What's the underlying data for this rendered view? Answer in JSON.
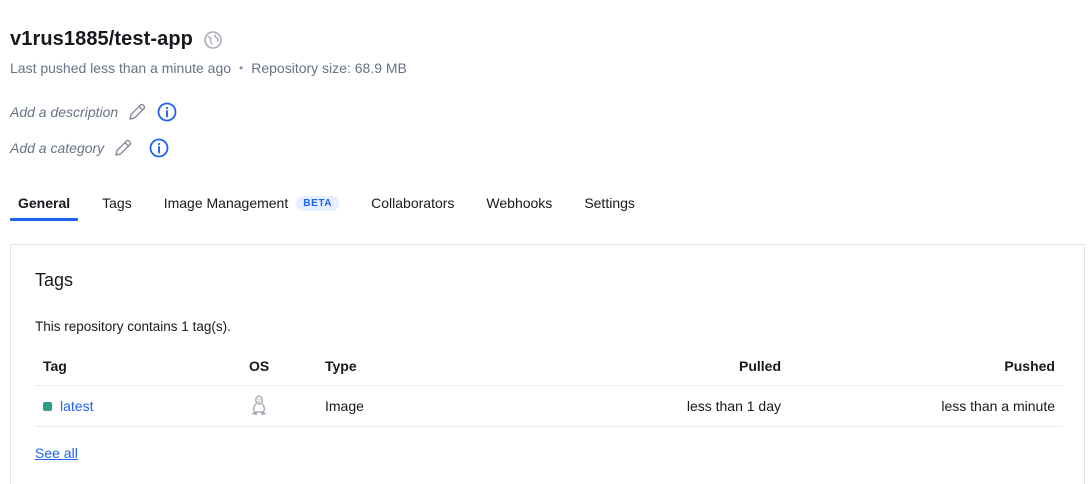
{
  "repo": {
    "name": "v1rus1885/test-app",
    "last_pushed": "Last pushed less than a minute ago",
    "separator": "•",
    "size": "Repository size: 68.9 MB"
  },
  "description": {
    "placeholder": "Add a description",
    "edit_icon": "pencil-icon",
    "info_icon": "info-icon"
  },
  "category": {
    "placeholder": "Add a category",
    "edit_icon": "pencil-icon",
    "info_icon": "info-icon"
  },
  "tabs": [
    {
      "label": "General",
      "active": true
    },
    {
      "label": "Tags",
      "active": false
    },
    {
      "label": "Image Management",
      "badge": "BETA",
      "active": false
    },
    {
      "label": "Collaborators",
      "active": false
    },
    {
      "label": "Webhooks",
      "active": false
    },
    {
      "label": "Settings",
      "active": false
    }
  ],
  "tags_card": {
    "title": "Tags",
    "summary": "This repository contains 1 tag(s).",
    "columns": [
      "Tag",
      "OS",
      "Type",
      "Pulled",
      "Pushed"
    ],
    "rows": [
      {
        "tag": "latest",
        "os_icon": "linux-icon",
        "type": "Image",
        "pulled": "less than 1 day",
        "pushed": "less than a minute",
        "status_color": "#2e9e86"
      }
    ],
    "see_all": "See all"
  },
  "colors": {
    "accent": "#1d63ed",
    "muted_text": "#677285",
    "text": "#17191e"
  }
}
